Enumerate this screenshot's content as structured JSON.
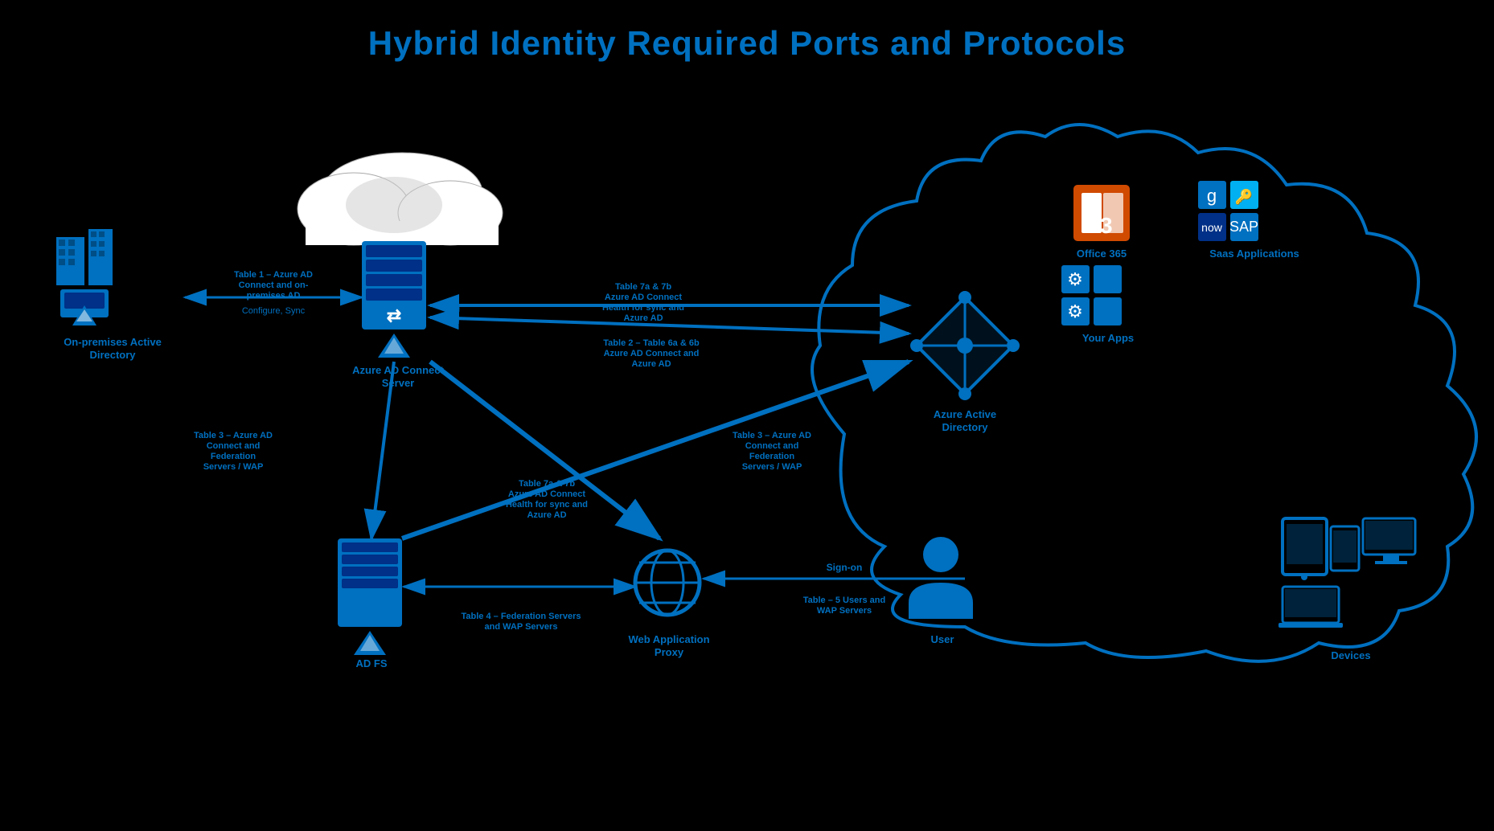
{
  "title": "Hybrid Identity Required Ports and Protocols",
  "nodes": {
    "onprem_ad": {
      "label": "On-premises Active\nDirectory",
      "label_multiline": [
        "On-premises Active",
        "Directory"
      ]
    },
    "azure_connect": {
      "label": "Azure AD Connect\nServer",
      "label_multiline": [
        "Azure AD Connect",
        "Server"
      ]
    },
    "adfs": {
      "label": "AD FS"
    },
    "wap": {
      "label": "Web Application\nProxy",
      "label_multiline": [
        "Web Application",
        "Proxy"
      ]
    },
    "user": {
      "label": "User"
    },
    "devices": {
      "label": "Devices"
    },
    "azure_ad": {
      "label": "Azure Active\nDirectory",
      "label_multiline": [
        "Azure Active",
        "Directory"
      ]
    },
    "office365": {
      "label": "Office 365"
    },
    "your_apps": {
      "label": "Your Apps"
    },
    "saas_apps": {
      "label": "Saas Applications"
    }
  },
  "connection_labels": {
    "table1": "Table 1 – Azure AD Connect and on-premises AD",
    "configure_sync": "Configure, Sync",
    "table2": "Table 2 – Table 6a & 6b Azure AD Connect and Azure AD",
    "table7a_top": "Table 7a & 7b Azure AD Connect Health for sync and Azure AD",
    "table3_left": "Table 3 – Azure AD Connect and Federation Servers / WAP",
    "table3_right": "Table 3 – Azure AD Connect and Federation Servers / WAP",
    "table7a_bottom": "Table 7a & 7b Azure AD Connect Health for sync and Azure AD",
    "table4": "Table 4 – Federation Servers and WAP Servers",
    "table5": "Sign-on\nTable – 5 Users and WAP Servers",
    "sign_on": "Sign-on",
    "table5_label": "Table – 5 Users and WAP Servers"
  },
  "colors": {
    "primary_blue": "#0070C0",
    "dark_blue": "#003087",
    "light_blue": "#00B0F0",
    "background": "#000000",
    "white": "#FFFFFF",
    "orange": "#D04A00"
  }
}
